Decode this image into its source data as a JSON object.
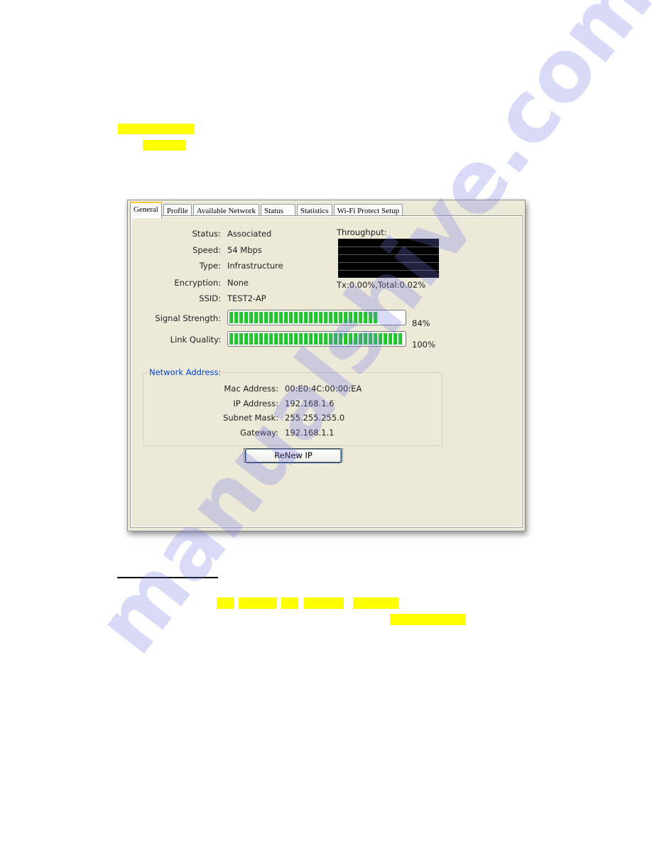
{
  "window": {
    "tabs": [
      {
        "label": "General",
        "active": true
      },
      {
        "label": "Profile",
        "active": false
      },
      {
        "label": "Available Network",
        "active": false
      },
      {
        "label": "Status",
        "active": false
      },
      {
        "label": "Statistics",
        "active": false
      },
      {
        "label": "Wi-Fi Protect Setup",
        "active": false
      }
    ],
    "general": {
      "status_label": "Status:",
      "status_value": "Associated",
      "speed_label": "Speed:",
      "speed_value": "54 Mbps",
      "type_label": "Type:",
      "type_value": "Infrastructure",
      "encryption_label": "Encryption:",
      "encryption_value": "None",
      "ssid_label": "SSID:",
      "ssid_value": "TEST2-AP",
      "throughput_label": "Throughput:",
      "throughput_text": "Tx:0.00%,Total:0.02%",
      "signal_label": "Signal Strength:",
      "signal_percent": 84,
      "signal_text": "84%",
      "link_label": "Link Quality:",
      "link_percent": 100,
      "link_text": "100%"
    },
    "network_address": {
      "title": "Network Address:",
      "mac_label": "Mac Address:",
      "mac_value": "00:E0:4C:00:00:EA",
      "ip_label": "IP Address:",
      "ip_value": "192.168.1.6",
      "mask_label": "Subnet Mask:",
      "mask_value": "255.255.255.0",
      "gateway_label": "Gateway:",
      "gateway_value": "192.168.1.1"
    },
    "renew_button": "ReNew IP"
  },
  "watermark": "manualshive.com",
  "colors": {
    "highlight": "#ffff00",
    "group_title": "#0046d5",
    "progress": "#2fcf3a"
  }
}
